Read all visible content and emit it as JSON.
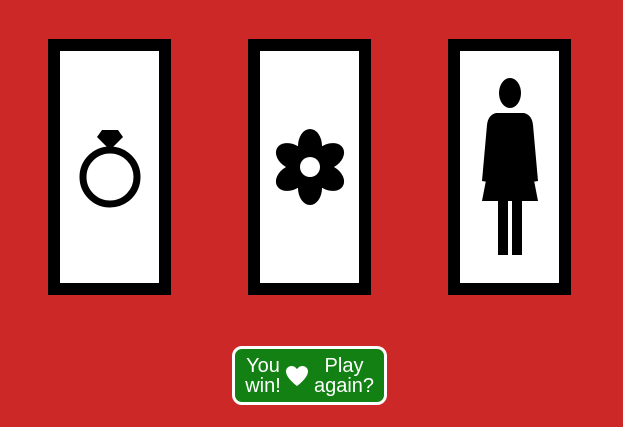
{
  "slots": [
    {
      "symbol": "ring-icon"
    },
    {
      "symbol": "flower-icon"
    },
    {
      "symbol": "woman-icon"
    }
  ],
  "result": {
    "status_line1": "You",
    "status_line2": "win!",
    "action_line1": "Play",
    "action_line2": "again?",
    "icon": "heart-icon",
    "background": "#138014"
  },
  "colors": {
    "page_background": "#cc2828",
    "slot_frame": "#000000",
    "slot_window": "#ffffff"
  }
}
